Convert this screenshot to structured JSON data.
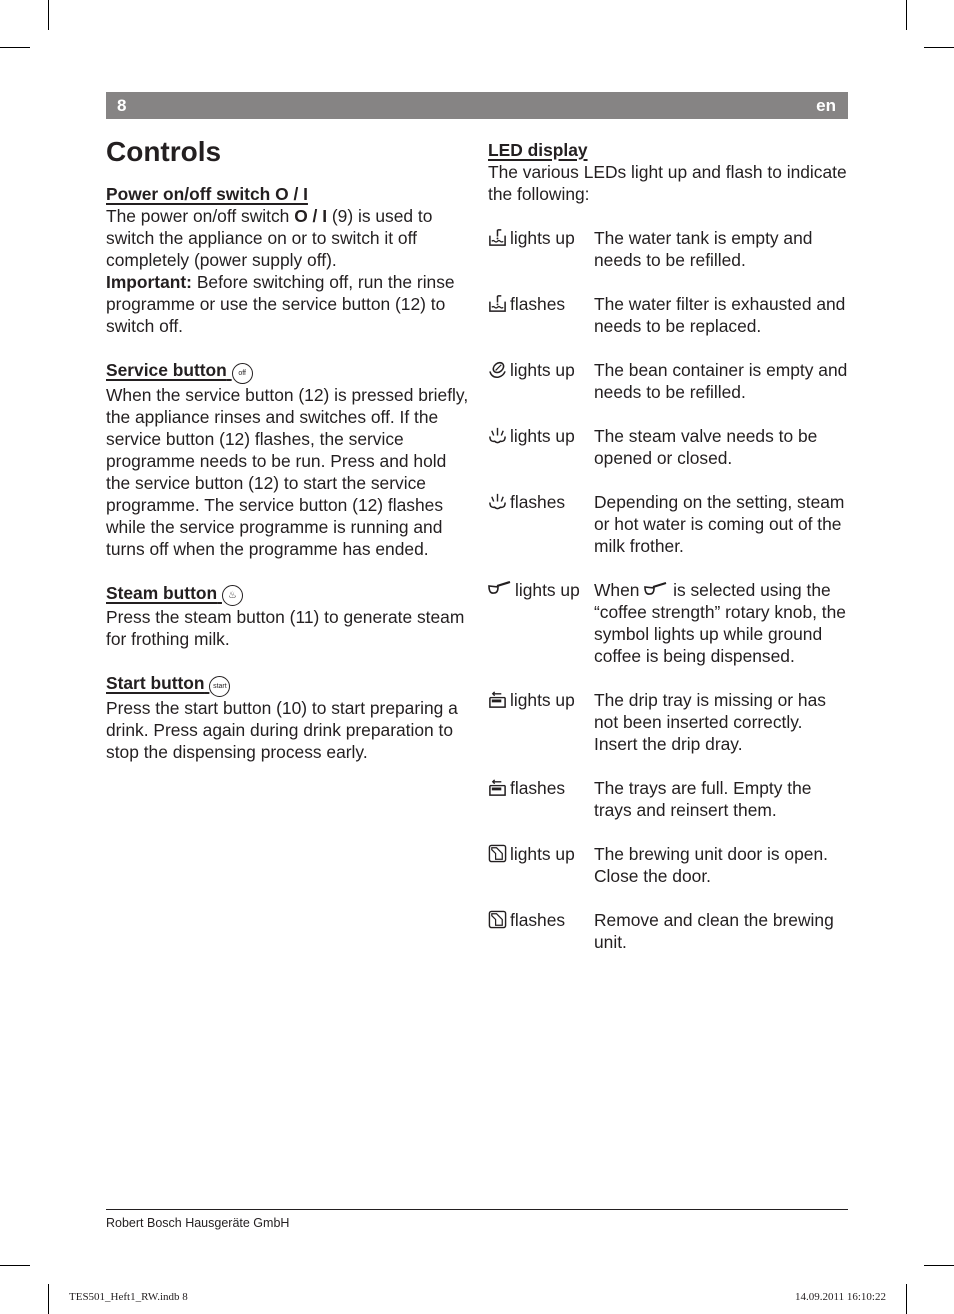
{
  "header": {
    "page_number": "8",
    "language": "en"
  },
  "title": "Controls",
  "left_sections": {
    "power": {
      "heading": "Power on/off switch O / I",
      "text_1": "The power on/off switch ",
      "switch_symbol": "O / I",
      "text_2": " (9) is used to switch the appliance on or to switch it off completely (power supply off).",
      "important_label": "Important:",
      "important_text": " Before switching off, run the rinse programme or use the service button (12) to switch off."
    },
    "service": {
      "heading": "Service button",
      "icon_label": "off",
      "text": "When the service button (12) is pressed briefly, the appliance rinses and switches off. If the service button (12) flashes, the service programme needs to be run. Press and hold the service button (12) to start the service programme. The service button (12) flashes while the service programme is running and turns off when the programme has ended."
    },
    "steam": {
      "heading": "Steam button",
      "text": "Press the steam button (11) to generate steam for frothing milk."
    },
    "start": {
      "heading": "Start button",
      "icon_label": "start",
      "text": "Press the start button (10) to start preparing a drink. Press again during drink preparation to stop the dispensing process early."
    }
  },
  "led": {
    "heading": "LED display",
    "intro": "The various LEDs light up and flash to indicate the following:",
    "rows": [
      {
        "icon": "water-tank-icon",
        "state": "lights up",
        "desc": "The water tank is empty and needs to be refilled."
      },
      {
        "icon": "water-tank-icon",
        "state": "flashes",
        "desc": "The water filter is exhausted and needs to be replaced."
      },
      {
        "icon": "coffee-bean-icon",
        "state": "lights up",
        "desc": "The bean container is empty and needs to be refilled."
      },
      {
        "icon": "steam-icon",
        "state": "lights up",
        "desc": "The steam valve needs to be opened or closed."
      },
      {
        "icon": "steam-icon",
        "state": "flashes",
        "desc": "Depending on the setting, steam or hot water is coming out of the milk frother."
      },
      {
        "icon": "ground-coffee-scoop-icon",
        "state": "lights up",
        "desc_1": "When ",
        "desc_2": " is selected using the “coffee strength” rotary knob, the symbol lights up while ground coffee is being dispensed."
      },
      {
        "icon": "drip-tray-icon",
        "state": "lights up",
        "desc": "The drip tray is missing or has not been inserted correctly. Insert the drip dray."
      },
      {
        "icon": "drip-tray-icon",
        "state": "flashes",
        "desc": "The trays are full. Empty the trays and reinsert them."
      },
      {
        "icon": "brewing-unit-door-icon",
        "state": "lights up",
        "desc": "The brewing unit door is open. Close the door."
      },
      {
        "icon": "brewing-unit-door-icon",
        "state": "flashes",
        "desc": "Remove and clean the brewing unit."
      }
    ]
  },
  "footer": {
    "company": "Robert Bosch Hausgeräte GmbH",
    "slug_file": "TES501_Heft1_RW.indb   8",
    "slug_date": "14.09.2011   16:10:22"
  }
}
